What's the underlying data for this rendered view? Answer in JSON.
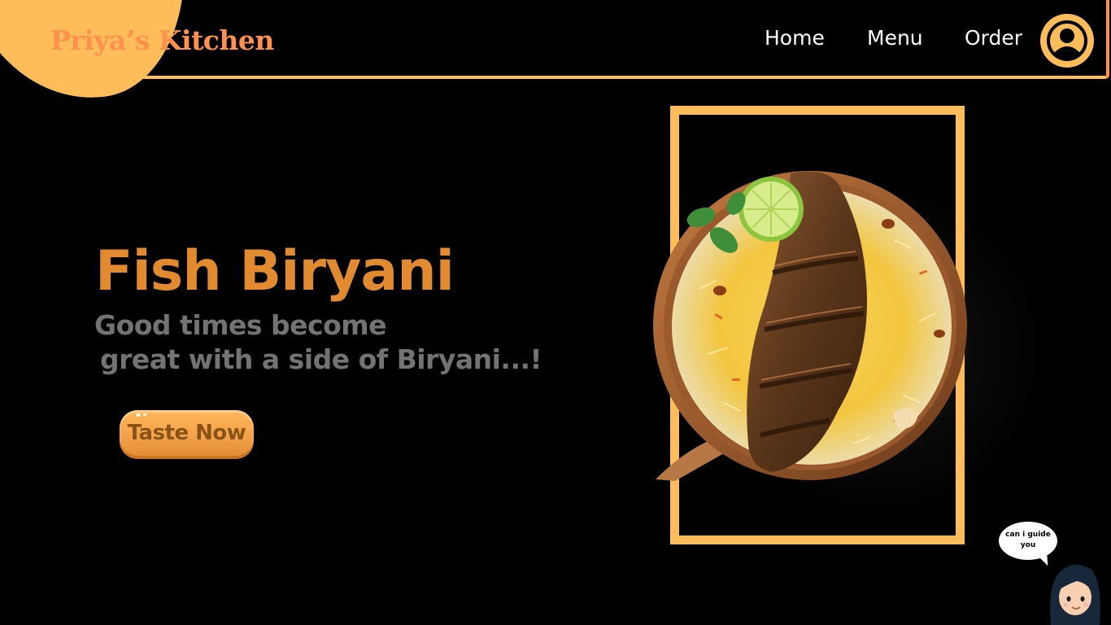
{
  "header": {
    "brand": "Priya’s Kitchen",
    "nav": [
      "Home",
      "Menu",
      "Order"
    ],
    "profile_icon": "user-icon"
  },
  "hero": {
    "title": "Fish Biryani",
    "subtitle_line1": "Good times become",
    "subtitle_line2": " great with a side of Biryani...!",
    "cta_label": "Taste Now"
  },
  "guide": {
    "bubble_text": "can i guide you"
  },
  "colors": {
    "accent": "#ffbd59",
    "brand_text": "#ff914d",
    "title": "#e18a2e",
    "subtitle": "#737373",
    "background": "#000000"
  }
}
